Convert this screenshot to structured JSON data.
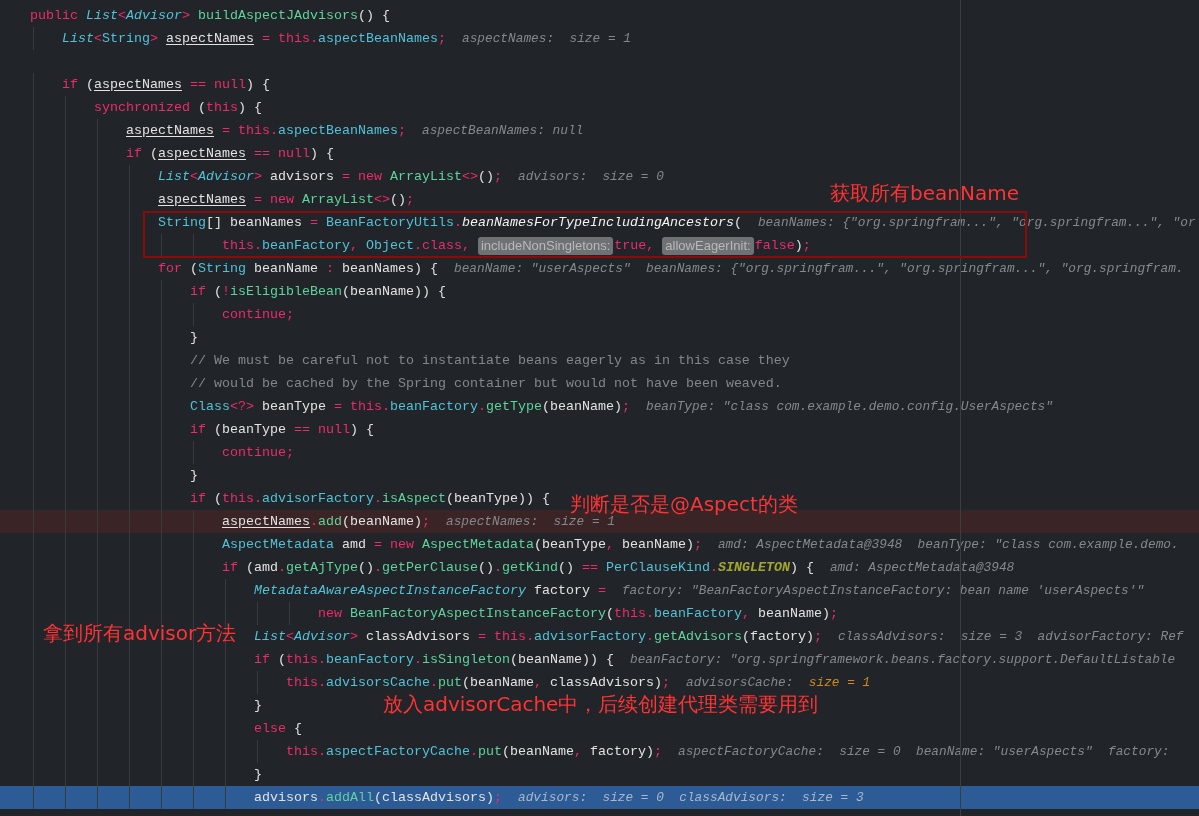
{
  "editor": {
    "lines": [
      {
        "breakpoint": false,
        "execution_point": false,
        "segments": [
          {
            "kind": "code",
            "tokens": [
              {
                "kind": "kw",
                "text": "public "
              },
              {
                "kind": "itype",
                "text": "List"
              },
              {
                "kind": "kw",
                "text": "<"
              },
              {
                "kind": "itype",
                "text": "Advisor"
              },
              {
                "kind": "kw",
                "text": "> "
              },
              {
                "kind": "method",
                "text": "buildAspectJAdvisors"
              },
              {
                "kind": "plain",
                "text": "() {"
              }
            ]
          }
        ]
      },
      {
        "breakpoint": false,
        "execution_point": false,
        "segments": [
          {
            "kind": "code",
            "tokens": [
              {
                "kind": "itype",
                "text": "    List"
              },
              {
                "kind": "kw",
                "text": "<"
              },
              {
                "kind": "type",
                "text": "String"
              },
              {
                "kind": "kw",
                "text": "> "
              },
              {
                "kind": "var",
                "text": "aspectNames"
              },
              {
                "kind": "kw",
                "text": " = this."
              },
              {
                "kind": "field",
                "text": "aspectBeanNames"
              },
              {
                "kind": "kw",
                "text": ";"
              }
            ]
          },
          {
            "kind": "hint",
            "tokens": [
              {
                "kind": "hint",
                "text": "aspectNames:  size = 1"
              }
            ]
          }
        ]
      },
      {
        "breakpoint": false,
        "execution_point": false
      },
      {
        "breakpoint": false,
        "execution_point": false,
        "segments": [
          {
            "kind": "code",
            "tokens": [
              {
                "kind": "kw",
                "text": "    if "
              },
              {
                "kind": "plain",
                "text": "("
              },
              {
                "kind": "var",
                "text": "aspectNames"
              },
              {
                "kind": "kw",
                "text": " == null"
              },
              {
                "kind": "plain",
                "text": ") {"
              }
            ]
          }
        ]
      },
      {
        "breakpoint": false,
        "execution_point": false,
        "segments": [
          {
            "kind": "code",
            "tokens": [
              {
                "kind": "kw",
                "text": "        synchronized "
              },
              {
                "kind": "plain",
                "text": "("
              },
              {
                "kind": "kw",
                "text": "this"
              },
              {
                "kind": "plain",
                "text": ") {"
              }
            ]
          }
        ]
      },
      {
        "breakpoint": false,
        "execution_point": false,
        "segments": [
          {
            "kind": "code",
            "tokens": [
              {
                "kind": "var",
                "text": "            aspectNames"
              },
              {
                "kind": "kw",
                "text": " = this."
              },
              {
                "kind": "field",
                "text": "aspectBeanNames"
              },
              {
                "kind": "kw",
                "text": ";"
              }
            ]
          },
          {
            "kind": "hint",
            "tokens": [
              {
                "kind": "hint",
                "text": "aspectBeanNames: null"
              }
            ]
          }
        ]
      },
      {
        "breakpoint": false,
        "execution_point": false,
        "segments": [
          {
            "kind": "code",
            "tokens": [
              {
                "kind": "kw",
                "text": "            if "
              },
              {
                "kind": "plain",
                "text": "("
              },
              {
                "kind": "var",
                "text": "aspectNames"
              },
              {
                "kind": "kw",
                "text": " == null"
              },
              {
                "kind": "plain",
                "text": ") {"
              }
            ]
          }
        ]
      },
      {
        "breakpoint": false,
        "execution_point": false,
        "segments": [
          {
            "kind": "code",
            "tokens": [
              {
                "kind": "itype",
                "text": "                List"
              },
              {
                "kind": "kw",
                "text": "<"
              },
              {
                "kind": "itype",
                "text": "Advisor"
              },
              {
                "kind": "kw",
                "text": "> "
              },
              {
                "kind": "plain",
                "text": "advisors "
              },
              {
                "kind": "kw",
                "text": "= new "
              },
              {
                "kind": "method",
                "text": "ArrayList"
              },
              {
                "kind": "kw",
                "text": "<>"
              },
              {
                "kind": "plain",
                "text": "()"
              },
              {
                "kind": "kw",
                "text": ";"
              }
            ]
          },
          {
            "kind": "hint",
            "tokens": [
              {
                "kind": "hint",
                "text": "advisors:  size = 0"
              }
            ]
          }
        ]
      },
      {
        "breakpoint": false,
        "execution_point": false,
        "segments": [
          {
            "kind": "code",
            "tokens": [
              {
                "kind": "var",
                "text": "                aspectNames"
              },
              {
                "kind": "kw",
                "text": " = new "
              },
              {
                "kind": "method",
                "text": "ArrayList"
              },
              {
                "kind": "kw",
                "text": "<>"
              },
              {
                "kind": "plain",
                "text": "()"
              },
              {
                "kind": "kw",
                "text": ";"
              }
            ]
          }
        ]
      },
      {
        "breakpoint": false,
        "execution_point": false,
        "segments": [
          {
            "kind": "code",
            "tokens": [
              {
                "kind": "type",
                "text": "                String"
              },
              {
                "kind": "plain",
                "text": "[] beanNames "
              },
              {
                "kind": "kw",
                "text": "= "
              },
              {
                "kind": "field",
                "text": "BeanFactoryUtils"
              },
              {
                "kind": "kw",
                "text": "."
              },
              {
                "kind": "imethod",
                "text": "beanNamesForTypeIncludingAncestors"
              },
              {
                "kind": "plain",
                "text": "("
              }
            ]
          },
          {
            "kind": "hint",
            "tokens": [
              {
                "kind": "hint",
                "text": "beanNames: {\"org.springfram...\", \"org.springfram...\", \"or"
              }
            ]
          }
        ]
      },
      {
        "breakpoint": false,
        "execution_point": false,
        "segments": [
          {
            "kind": "code",
            "tokens": [
              {
                "kind": "kw",
                "text": "                        this."
              },
              {
                "kind": "field",
                "text": "beanFactory"
              },
              {
                "kind": "kw",
                "text": ", "
              },
              {
                "kind": "field",
                "text": "Object"
              },
              {
                "kind": "kw",
                "text": ".class, "
              }
            ]
          },
          {
            "kind": "param",
            "text": "includeNonSingletons:"
          },
          {
            "kind": "code",
            "tokens": [
              {
                "kind": "kw",
                "text": "true, "
              }
            ]
          },
          {
            "kind": "param",
            "text": "allowEagerInit:"
          },
          {
            "kind": "code",
            "tokens": [
              {
                "kind": "kw",
                "text": "false"
              },
              {
                "kind": "plain",
                "text": ")"
              },
              {
                "kind": "kw",
                "text": ";"
              }
            ]
          }
        ]
      },
      {
        "breakpoint": false,
        "execution_point": false,
        "segments": [
          {
            "kind": "code",
            "tokens": [
              {
                "kind": "kw",
                "text": "                for "
              },
              {
                "kind": "plain",
                "text": "("
              },
              {
                "kind": "type",
                "text": "String"
              },
              {
                "kind": "plain",
                "text": " beanName "
              },
              {
                "kind": "kw",
                "text": ": "
              },
              {
                "kind": "plain",
                "text": "beanNames) {"
              }
            ]
          },
          {
            "kind": "hint",
            "tokens": [
              {
                "kind": "hint",
                "text": "beanName: \"userAspects\"  beanNames: {\"org.springfram...\", \"org.springfram...\", \"org.springfram."
              }
            ]
          }
        ]
      },
      {
        "breakpoint": false,
        "execution_point": false,
        "segments": [
          {
            "kind": "code",
            "tokens": [
              {
                "kind": "kw",
                "text": "                    if "
              },
              {
                "kind": "plain",
                "text": "("
              },
              {
                "kind": "kw",
                "text": "!"
              },
              {
                "kind": "method",
                "text": "isEligibleBean"
              },
              {
                "kind": "plain",
                "text": "(beanName)) {"
              }
            ]
          }
        ]
      },
      {
        "breakpoint": false,
        "execution_point": false,
        "segments": [
          {
            "kind": "code",
            "tokens": [
              {
                "kind": "kw",
                "text": "                        continue;"
              }
            ]
          }
        ]
      },
      {
        "breakpoint": false,
        "execution_point": false,
        "segments": [
          {
            "kind": "code",
            "tokens": [
              {
                "kind": "plain",
                "text": "                    }"
              }
            ]
          }
        ]
      },
      {
        "breakpoint": false,
        "execution_point": false,
        "segments": [
          {
            "kind": "code",
            "tokens": [
              {
                "kind": "comment",
                "text": "                    // We must be careful not to instantiate beans eagerly as in this case they"
              }
            ]
          }
        ]
      },
      {
        "breakpoint": false,
        "execution_point": false,
        "segments": [
          {
            "kind": "code",
            "tokens": [
              {
                "kind": "comment",
                "text": "                    // would be cached by the Spring container but would not have been weaved."
              }
            ]
          }
        ]
      },
      {
        "breakpoint": false,
        "execution_point": false,
        "segments": [
          {
            "kind": "code",
            "tokens": [
              {
                "kind": "type",
                "text": "                    Class"
              },
              {
                "kind": "kw",
                "text": "<?> "
              },
              {
                "kind": "plain",
                "text": "beanType "
              },
              {
                "kind": "kw",
                "text": "= this."
              },
              {
                "kind": "field",
                "text": "beanFactory"
              },
              {
                "kind": "kw",
                "text": "."
              },
              {
                "kind": "method",
                "text": "getType"
              },
              {
                "kind": "plain",
                "text": "(beanName)"
              },
              {
                "kind": "kw",
                "text": ";"
              }
            ]
          },
          {
            "kind": "hint",
            "tokens": [
              {
                "kind": "hint",
                "text": "beanType: \"class com.example.demo.config.UserAspects\""
              }
            ]
          }
        ]
      },
      {
        "breakpoint": false,
        "execution_point": false,
        "segments": [
          {
            "kind": "code",
            "tokens": [
              {
                "kind": "kw",
                "text": "                    if "
              },
              {
                "kind": "plain",
                "text": "(beanType "
              },
              {
                "kind": "kw",
                "text": "== null"
              },
              {
                "kind": "plain",
                "text": ") {"
              }
            ]
          }
        ]
      },
      {
        "breakpoint": false,
        "execution_point": false,
        "segments": [
          {
            "kind": "code",
            "tokens": [
              {
                "kind": "kw",
                "text": "                        continue;"
              }
            ]
          }
        ]
      },
      {
        "breakpoint": false,
        "execution_point": false,
        "segments": [
          {
            "kind": "code",
            "tokens": [
              {
                "kind": "plain",
                "text": "                    }"
              }
            ]
          }
        ]
      },
      {
        "breakpoint": false,
        "execution_point": false,
        "segments": [
          {
            "kind": "code",
            "tokens": [
              {
                "kind": "kw",
                "text": "                    if "
              },
              {
                "kind": "plain",
                "text": "("
              },
              {
                "kind": "kw",
                "text": "this."
              },
              {
                "kind": "field",
                "text": "advisorFactory"
              },
              {
                "kind": "kw",
                "text": "."
              },
              {
                "kind": "method",
                "text": "isAspect"
              },
              {
                "kind": "plain",
                "text": "(beanType)) {"
              }
            ]
          }
        ]
      },
      {
        "breakpoint": true,
        "execution_point": false,
        "segments": [
          {
            "kind": "code",
            "tokens": [
              {
                "kind": "var",
                "text": "                        aspectNames"
              },
              {
                "kind": "kw",
                "text": "."
              },
              {
                "kind": "method",
                "text": "add"
              },
              {
                "kind": "plain",
                "text": "(beanName)"
              },
              {
                "kind": "kw",
                "text": ";"
              }
            ]
          },
          {
            "kind": "hint",
            "tokens": [
              {
                "kind": "hint",
                "text": "aspectNames:  size = 1"
              }
            ]
          }
        ]
      },
      {
        "breakpoint": false,
        "execution_point": false,
        "segments": [
          {
            "kind": "code",
            "tokens": [
              {
                "kind": "type",
                "text": "                        AspectMetadata"
              },
              {
                "kind": "plain",
                "text": " amd "
              },
              {
                "kind": "kw",
                "text": "= new "
              },
              {
                "kind": "method",
                "text": "AspectMetadata"
              },
              {
                "kind": "plain",
                "text": "(beanType"
              },
              {
                "kind": "kw",
                "text": ", "
              },
              {
                "kind": "plain",
                "text": "beanName)"
              },
              {
                "kind": "kw",
                "text": ";"
              }
            ]
          },
          {
            "kind": "hint",
            "tokens": [
              {
                "kind": "hint",
                "text": "amd: AspectMetadata@3948  beanType: \"class com.example.demo."
              }
            ]
          }
        ]
      },
      {
        "breakpoint": false,
        "execution_point": false,
        "segments": [
          {
            "kind": "code",
            "tokens": [
              {
                "kind": "kw",
                "text": "                        if "
              },
              {
                "kind": "plain",
                "text": "(amd"
              },
              {
                "kind": "kw",
                "text": "."
              },
              {
                "kind": "method",
                "text": "getAjType"
              },
              {
                "kind": "plain",
                "text": "()"
              },
              {
                "kind": "kw",
                "text": "."
              },
              {
                "kind": "method",
                "text": "getPerClause"
              },
              {
                "kind": "plain",
                "text": "()"
              },
              {
                "kind": "kw",
                "text": "."
              },
              {
                "kind": "method",
                "text": "getKind"
              },
              {
                "kind": "plain",
                "text": "() "
              },
              {
                "kind": "kw",
                "text": "== "
              },
              {
                "kind": "field",
                "text": "PerClauseKind"
              },
              {
                "kind": "kw",
                "text": "."
              },
              {
                "kind": "const",
                "text": "SINGLETON"
              },
              {
                "kind": "plain",
                "text": ") {"
              }
            ]
          },
          {
            "kind": "hint",
            "tokens": [
              {
                "kind": "hint",
                "text": "amd: AspectMetadata@3948"
              }
            ]
          }
        ]
      },
      {
        "breakpoint": false,
        "execution_point": false,
        "segments": [
          {
            "kind": "code",
            "tokens": [
              {
                "kind": "itype",
                "text": "                            MetadataAwareAspectInstanceFactory"
              },
              {
                "kind": "plain",
                "text": " factory "
              },
              {
                "kind": "kw",
                "text": "="
              }
            ]
          },
          {
            "kind": "hint",
            "tokens": [
              {
                "kind": "hint",
                "text": "factory: \"BeanFactoryAspectInstanceFactory: bean name 'userAspects'\""
              }
            ]
          }
        ]
      },
      {
        "breakpoint": false,
        "execution_point": false,
        "segments": [
          {
            "kind": "code",
            "tokens": [
              {
                "kind": "kw",
                "text": "                                    new "
              },
              {
                "kind": "method",
                "text": "BeanFactoryAspectInstanceFactory"
              },
              {
                "kind": "plain",
                "text": "("
              },
              {
                "kind": "kw",
                "text": "this."
              },
              {
                "kind": "field",
                "text": "beanFactory"
              },
              {
                "kind": "kw",
                "text": ", "
              },
              {
                "kind": "plain",
                "text": "beanName)"
              },
              {
                "kind": "kw",
                "text": ";"
              }
            ]
          }
        ]
      },
      {
        "breakpoint": false,
        "execution_point": false,
        "segments": [
          {
            "kind": "code",
            "tokens": [
              {
                "kind": "itype",
                "text": "                            List"
              },
              {
                "kind": "kw",
                "text": "<"
              },
              {
                "kind": "itype",
                "text": "Advisor"
              },
              {
                "kind": "kw",
                "text": "> "
              },
              {
                "kind": "plain",
                "text": "classAdvisors "
              },
              {
                "kind": "kw",
                "text": "= this."
              },
              {
                "kind": "field",
                "text": "advisorFactory"
              },
              {
                "kind": "kw",
                "text": "."
              },
              {
                "kind": "method",
                "text": "getAdvisors"
              },
              {
                "kind": "plain",
                "text": "(factory)"
              },
              {
                "kind": "kw",
                "text": ";"
              }
            ]
          },
          {
            "kind": "hint",
            "tokens": [
              {
                "kind": "hint",
                "text": "classAdvisors:  size = 3  advisorFactory: Ref"
              }
            ]
          }
        ]
      },
      {
        "breakpoint": false,
        "execution_point": false,
        "segments": [
          {
            "kind": "code",
            "tokens": [
              {
                "kind": "kw",
                "text": "                            if "
              },
              {
                "kind": "plain",
                "text": "("
              },
              {
                "kind": "kw",
                "text": "this."
              },
              {
                "kind": "field",
                "text": "beanFactory"
              },
              {
                "kind": "kw",
                "text": "."
              },
              {
                "kind": "method",
                "text": "isSingleton"
              },
              {
                "kind": "plain",
                "text": "(beanName)) {"
              }
            ]
          },
          {
            "kind": "hint",
            "tokens": [
              {
                "kind": "hint",
                "text": "beanFactory: \"org.springframework.beans.factory.support.DefaultListable"
              }
            ]
          }
        ]
      },
      {
        "breakpoint": false,
        "execution_point": false,
        "segments": [
          {
            "kind": "code",
            "tokens": [
              {
                "kind": "kw",
                "text": "                                this."
              },
              {
                "kind": "field",
                "text": "advisorsCache"
              },
              {
                "kind": "kw",
                "text": "."
              },
              {
                "kind": "method",
                "text": "put"
              },
              {
                "kind": "plain",
                "text": "(beanName"
              },
              {
                "kind": "kw",
                "text": ", "
              },
              {
                "kind": "plain",
                "text": "classAdvisors)"
              },
              {
                "kind": "kw",
                "text": ";"
              }
            ]
          },
          {
            "kind": "hint",
            "tokens": [
              {
                "kind": "hint",
                "text": "advisorsCache:  "
              },
              {
                "kind": "changed",
                "text": "size = 1"
              }
            ]
          }
        ]
      },
      {
        "breakpoint": false,
        "execution_point": false,
        "segments": [
          {
            "kind": "code",
            "tokens": [
              {
                "kind": "plain",
                "text": "                            }"
              }
            ]
          }
        ]
      },
      {
        "breakpoint": false,
        "execution_point": false,
        "segments": [
          {
            "kind": "code",
            "tokens": [
              {
                "kind": "kw",
                "text": "                            else "
              },
              {
                "kind": "plain",
                "text": "{"
              }
            ]
          }
        ]
      },
      {
        "breakpoint": false,
        "execution_point": false,
        "segments": [
          {
            "kind": "code",
            "tokens": [
              {
                "kind": "kw",
                "text": "                                this."
              },
              {
                "kind": "field",
                "text": "aspectFactoryCache"
              },
              {
                "kind": "kw",
                "text": "."
              },
              {
                "kind": "method",
                "text": "put"
              },
              {
                "kind": "plain",
                "text": "(beanName"
              },
              {
                "kind": "kw",
                "text": ", "
              },
              {
                "kind": "plain",
                "text": "factory)"
              },
              {
                "kind": "kw",
                "text": ";"
              }
            ]
          },
          {
            "kind": "hint",
            "tokens": [
              {
                "kind": "hint",
                "text": "aspectFactoryCache:  size = 0  beanName: \"userAspects\"  factory:"
              }
            ]
          }
        ]
      },
      {
        "breakpoint": false,
        "execution_point": false,
        "segments": [
          {
            "kind": "code",
            "tokens": [
              {
                "kind": "plain",
                "text": "                            }"
              }
            ]
          }
        ]
      },
      {
        "breakpoint": false,
        "execution_point": true,
        "segments": [
          {
            "kind": "code",
            "tokens": [
              {
                "kind": "plain",
                "text": "                            advisors"
              },
              {
                "kind": "kw",
                "text": "."
              },
              {
                "kind": "method",
                "text": "addAll"
              },
              {
                "kind": "plain",
                "text": "(classAdvisors)"
              },
              {
                "kind": "kw",
                "text": ";"
              }
            ]
          },
          {
            "kind": "hint",
            "tokens": [
              {
                "kind": "hint",
                "text": "advisors:  size = 0  classAdvisors:  size = 3"
              }
            ]
          }
        ]
      }
    ]
  },
  "annotations": [
    {
      "text": "获取所有beanName"
    },
    {
      "text": "判断是否是@Aspect的类"
    },
    {
      "text": "拿到所有advisor方法"
    },
    {
      "text": "放入advisorCache中，后续创建代理类需要用到"
    }
  ]
}
